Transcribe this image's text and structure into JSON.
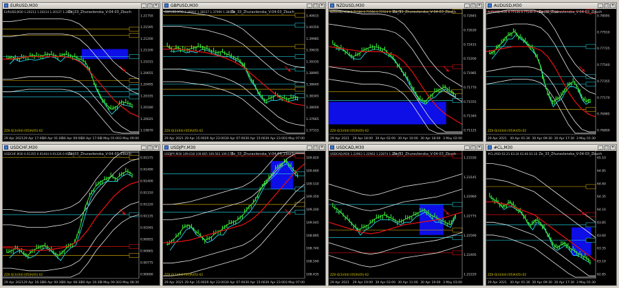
{
  "window_controls": {
    "minimize": "_",
    "maximize": "□",
    "close": "×"
  },
  "indicator_label": "Ze_33_Zhuravlenska_V-04-03_Zbuch",
  "footer_label": "ZZII-Q(3)(04)-[05]A(05)-02",
  "colors": {
    "bg": "#000000",
    "price": "#39e639",
    "ema": "#e01010",
    "bands": "#e8e8e8",
    "cyan_curve": "#28d8f0",
    "zone_blue": "#1010ff",
    "level_gold": "#c8a000",
    "level_cyan": "#20c8d8"
  },
  "windows": [
    {
      "title": "EURUSD,M30",
      "ohlc": "EURUSD,M30  1.20213 1.20214 1.20127 1.20211",
      "price_labels": [
        "1.21750",
        "1.21595",
        "1.21200",
        "1.21100",
        "1.21015",
        "1.20655",
        "1.20495",
        "1.20335",
        "1.20180",
        "1.20025",
        "1.19870"
      ],
      "time_labels": [
        "29 Apr 2021",
        "29 Apr 17:00",
        "30 Apr 01:00",
        "30 Apr 09:00",
        "30 Apr 17:00",
        "3 May 01:00",
        "3 May 09:00"
      ]
    },
    {
      "title": "GBPUSD,M30",
      "ohlc": "GBPUSD,M30  1.38097 1.38157 1.37999 1.38088",
      "price_labels": [
        "1.40615",
        "1.40350",
        "1.39985",
        "1.39635",
        "1.39335",
        "1.38995",
        "1.38640",
        "1.38345",
        "1.38000",
        "1.37665",
        "1.37315"
      ],
      "time_labels": [
        "29 Apr 2021",
        "29 Apr 15:00",
        "29 Apr 23:00",
        "30 Apr 07:00",
        "30 Apr 15:00",
        "30 Apr 23:00",
        "3 May 07:00"
      ]
    },
    {
      "title": "NZDUSD,M30",
      "ohlc": "NZDUSD,M30  0.71590 0.71590 0.71524 0.71573",
      "price_labels": [
        "0.72845",
        "0.72630",
        "0.72415",
        "0.72200",
        "0.71985",
        "0.71770",
        "0.71555",
        "0.71340",
        "0.71125"
      ],
      "time_labels": [
        "29 Apr 2021",
        "29 Apr 18:00",
        "30 Apr 02:00",
        "30 Apr 10:00",
        "30 Apr 18:00",
        "3 May 02:00"
      ]
    },
    {
      "title": "AUDUSD,M30",
      "ohlc": "AUDUSD,M30  0.77136 0.77140 0.77040 0.77136",
      "price_labels": [
        "0.78095",
        "0.77910",
        "0.77725",
        "0.77540",
        "0.77355",
        "0.77170",
        "0.76985",
        "0.76800"
      ],
      "time_labels": [
        "29 Apr 2021",
        "30 Apr 01:30",
        "30 Apr 09:30",
        "30 Apr 17:30",
        "3 May 01:30"
      ]
    },
    {
      "title": "USDCHF,M30",
      "ohlc": "USDCHF,M30  0.91355 0.91404 0.91326 0.91329",
      "price_labels": [
        "0.91575",
        "0.91490",
        "0.91400",
        "0.91310",
        "0.91220",
        "0.91135",
        "0.91045",
        "0.90955",
        "0.90865",
        "0.90775",
        "0.90690"
      ],
      "time_labels": [
        "29 Apr 2021",
        "29 Apr 16:30",
        "30 Apr 00:30",
        "30 Apr 08:30",
        "30 Apr 16:30",
        "3 May 00:30",
        "3 May 08:30"
      ]
    },
    {
      "title": "USDJPY,M30",
      "ohlc": "USDJPY,M30  109.618 109.665 109.563 109.578",
      "price_labels": [
        "109.820",
        "109.660",
        "109.510",
        "109.350",
        "109.200",
        "109.045",
        "108.895",
        "108.740",
        "108.590",
        "108.435"
      ],
      "time_labels": [
        "29 Apr 2021",
        "29 Apr 15:00",
        "29 Apr 23:00",
        "30 Apr 07:00",
        "30 Apr 15:00",
        "30 Apr 23:00",
        "3 May 07:00"
      ]
    },
    {
      "title": "USDCAD,M30",
      "ohlc": "USDCAD,M30  1.22963 1.22963 1.22874 1.22945",
      "price_labels": [
        "1.23330",
        "1.23145",
        "1.22960",
        "1.22775",
        "1.22590",
        "1.22405",
        "1.22220"
      ],
      "time_labels": [
        "29 Apr 2021",
        "29 Apr 19:00",
        "30 Apr 03:00",
        "30 Apr 11:00",
        "30 Apr 19:00",
        "3 May 03:00"
      ]
    },
    {
      "title": "#CL,M30",
      "ohlc": "#CL,M30  63.21 63.24 63.06 63.10",
      "price_labels": [
        "65.10",
        "64.85",
        "64.60",
        "64.35",
        "64.10",
        "63.85",
        "63.60",
        "63.35",
        "63.10",
        "62.85"
      ],
      "time_labels": [
        "29 Apr 2021",
        "30 Apr 01:30",
        "30 Apr 09:30",
        "30 Apr 17:30",
        "3 May 01:30"
      ]
    }
  ]
}
